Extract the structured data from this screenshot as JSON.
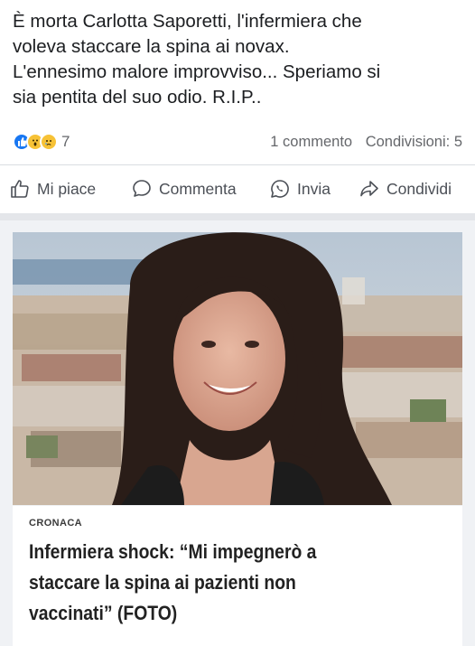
{
  "post": {
    "text_lines": [
      "È morta Carlotta Saporetti, l'infermiera che",
      "voleva staccare la spina ai novax.",
      "L'ennesimo malore improvviso... Speriamo si",
      "sia pentita del suo odio. R.I.P.."
    ]
  },
  "stats": {
    "reactions": [
      "like",
      "wow",
      "sad"
    ],
    "reaction_count": "7",
    "comments": "1 commento",
    "shares": "Condivisioni: 5"
  },
  "actions": {
    "like": "Mi piace",
    "comment": "Commenta",
    "send": "Invia",
    "share": "Condividi"
  },
  "link_card": {
    "category": "CRONACA",
    "headline_lines": [
      "Infermiera shock: “Mi impegnerò a",
      "staccare la spina ai pazienti non",
      "vaccinati” (FOTO)"
    ]
  },
  "colors": {
    "like_blue": "#1877f2",
    "reaction_yellow": "#f7c236",
    "secondary_text": "#65676b",
    "card_background": "#f0f2f5"
  }
}
